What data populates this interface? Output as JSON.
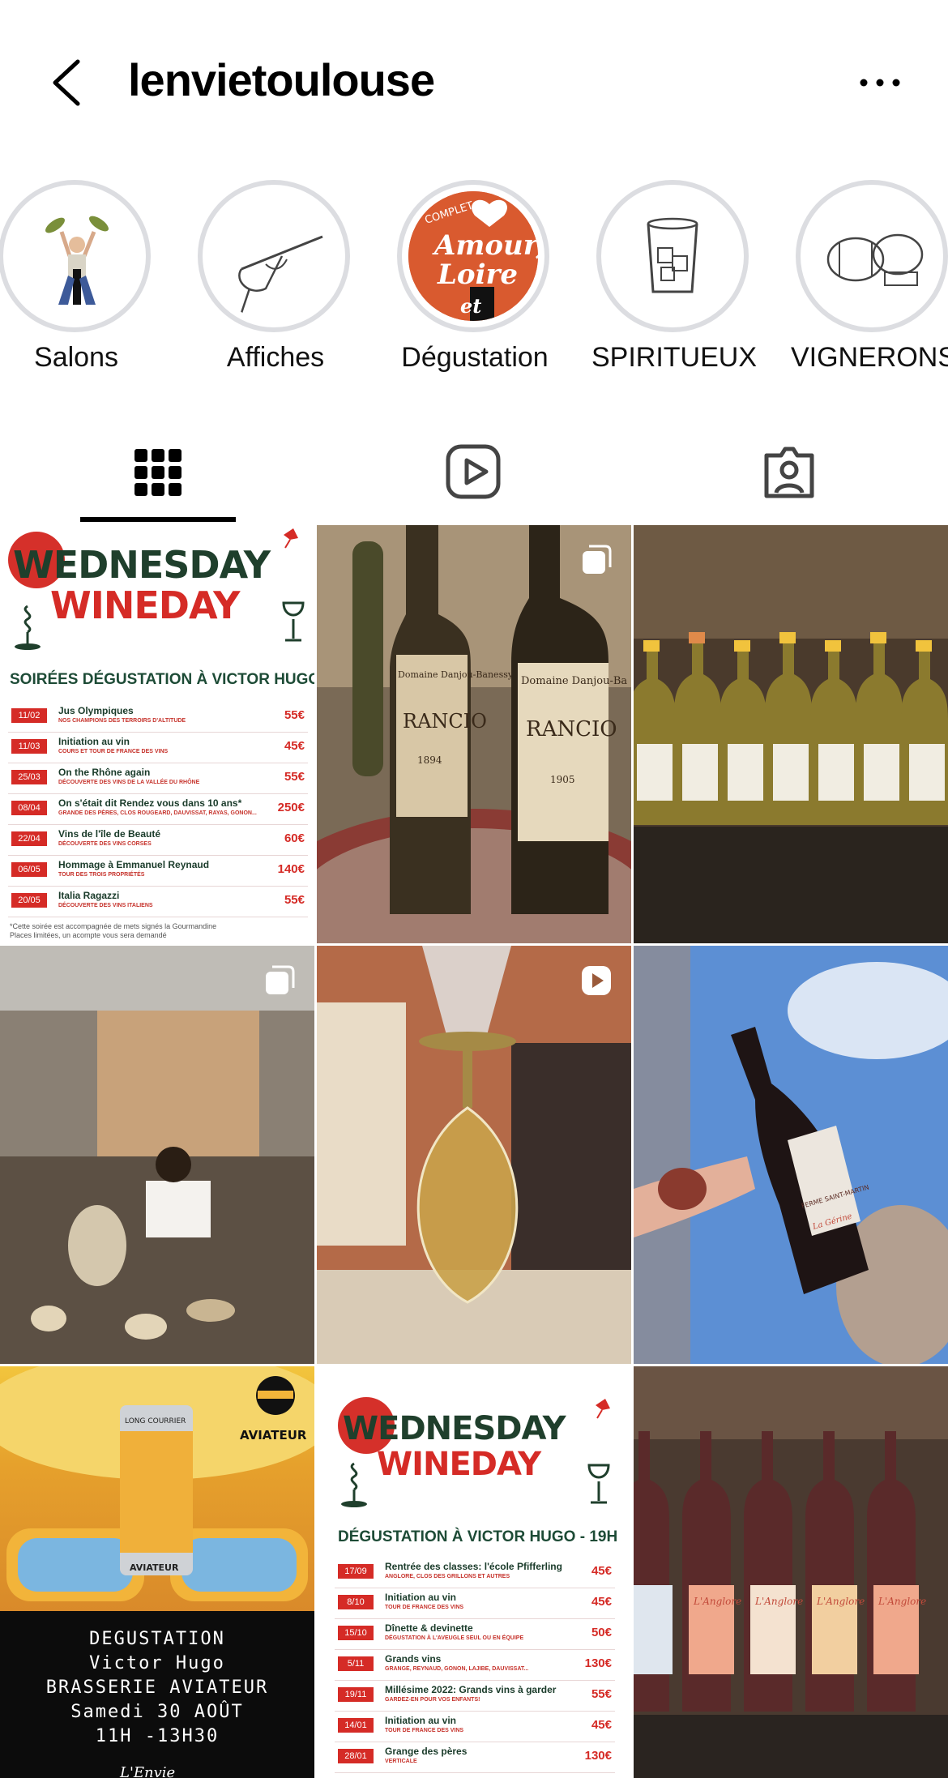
{
  "header": {
    "username": "lenvietoulouse"
  },
  "highlights": [
    {
      "label": "Salons"
    },
    {
      "label": "Affiches"
    },
    {
      "label": "Dégustation",
      "image_text": [
        "COMPLET",
        "Amour,",
        "Loire",
        "et"
      ]
    },
    {
      "label": "SPIRITUEUX"
    },
    {
      "label": "VIGNERONS"
    }
  ],
  "tabs": [
    {
      "name": "grid",
      "icon": "grid-icon",
      "active": true
    },
    {
      "name": "reels",
      "icon": "reels-icon",
      "active": false
    },
    {
      "name": "tagged",
      "icon": "tagged-icon",
      "active": false
    }
  ],
  "posts": {
    "poster1": {
      "title_line1": "WEDNESDAY",
      "title_line2": "WINEDAY",
      "subtitle": "SOIRÉES DÉGUSTATION À VICTOR HUGO",
      "rows": [
        {
          "date": "11/02",
          "name": "Jus Olympiques",
          "desc": "NOS CHAMPIONS DES TERROIRS D'ALTITUDE",
          "price": "55€"
        },
        {
          "date": "11/03",
          "name": "Initiation au vin",
          "desc": "COURS ET TOUR DE FRANCE DES VINS",
          "price": "45€"
        },
        {
          "date": "25/03",
          "name": "On the Rhône again",
          "desc": "DÉCOUVERTE DES VINS DE LA VALLÉE DU RHÔNE",
          "price": "55€"
        },
        {
          "date": "08/04",
          "name": "On s'était dit Rendez vous dans 10 ans*",
          "desc": "GRANDE DES PÈRES, CLOS ROUGEARD, DAUVISSAT, RAYAS, GONON...",
          "price": "250€"
        },
        {
          "date": "22/04",
          "name": "Vins de l'île de Beauté",
          "desc": "DÉCOUVERTE DES VINS CORSES",
          "price": "60€"
        },
        {
          "date": "06/05",
          "name": "Hommage à Emmanuel Reynaud",
          "desc": "TOUR DES TROIS PROPRIÉTÉS",
          "price": "140€"
        },
        {
          "date": "20/05",
          "name": "Italia Ragazzi",
          "desc": "DÉCOUVERTE DES VINS ITALIENS",
          "price": "55€"
        }
      ],
      "note_line1": "*Cette soirée est accompagnée de mets signés la Gourmandine",
      "note_line2": "Places limitées, un acompte vous sera demandé"
    },
    "photo_rancio": {
      "label_left": "Domaine Danjou-Banessy",
      "label_right": "Domaine Danjou-Ba",
      "wine_left": "RANCIO",
      "wine_right": "RANCIO",
      "year_left": "1894",
      "year_right": "1905"
    },
    "photo_bottle": {
      "label": "FERME SAINT-MARTIN",
      "cuvee": "La Gérine"
    },
    "aviateur": {
      "brand_top": "LONG COURRIER",
      "brand": "AVIATEUR",
      "can_label": "AVIATEUR",
      "lines": [
        "DEGUSTATION",
        "Victor Hugo",
        "BRASSERIE AVIATEUR",
        "Samedi 30 AOÛT",
        "11H -13H30"
      ],
      "logo": "L'Envie"
    },
    "poster2": {
      "title_line1": "WEDNESDAY",
      "title_line2": "WINEDAY",
      "subtitle": "DÉGUSTATION À VICTOR HUGO - 19H",
      "rows": [
        {
          "date": "17/09",
          "name": "Rentrée des classes: l'école Pfifferling",
          "desc": "ANGLORE, CLOS DES GRILLONS ET AUTRES",
          "price": "45€"
        },
        {
          "date": "8/10",
          "name": "Initiation au vin",
          "desc": "TOUR DE FRANCE DES VINS",
          "price": "45€"
        },
        {
          "date": "15/10",
          "name": "Dînette & devinette",
          "desc": "DÉGUSTATION À L'AVEUGLE SEUL OU EN ÉQUIPE",
          "price": "50€"
        },
        {
          "date": "5/11",
          "name": "Grands vins",
          "desc": "GRANGE, REYNAUD, GONON, LAJIBE, DAUVISSAT...",
          "price": "130€"
        },
        {
          "date": "19/11",
          "name": "Millésime 2022: Grands vins à garder",
          "desc": "GARDEZ-EN POUR VOS ENFANTS!",
          "price": "55€"
        },
        {
          "date": "14/01",
          "name": "Initiation au vin",
          "desc": "TOUR DE FRANCE DES VINS",
          "price": "45€"
        },
        {
          "date": "28/01",
          "name": "Grange des pères",
          "desc": "VERTICALE",
          "price": "130€"
        }
      ]
    },
    "photo_anglore": {
      "brand": "L'Anglore"
    }
  },
  "colors": {
    "poster_green": "#1f3f2c",
    "poster_red": "#d52b26",
    "ring_grey": "#dcdde1"
  }
}
